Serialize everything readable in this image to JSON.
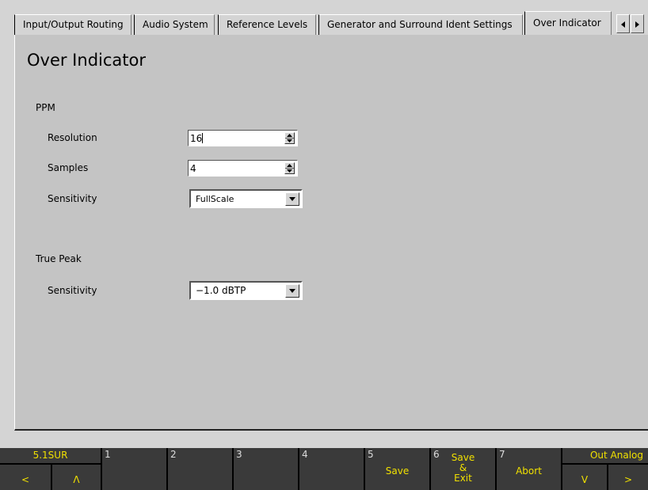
{
  "tabs": [
    {
      "label": "Input/Output Routing",
      "active": false
    },
    {
      "label": "Audio System",
      "active": false
    },
    {
      "label": "Reference Levels",
      "active": false
    },
    {
      "label": "Generator and Surround Ident Settings",
      "active": false
    },
    {
      "label": "Over Indicator",
      "active": true
    }
  ],
  "page": {
    "title": "Over Indicator",
    "ppm": {
      "section_label": "PPM",
      "resolution": {
        "label": "Resolution",
        "value": "16"
      },
      "samples": {
        "label": "Samples",
        "value": "4"
      },
      "sensitivity": {
        "label": "Sensitivity",
        "value": "FullScale"
      }
    },
    "true_peak": {
      "section_label": "True Peak",
      "sensitivity": {
        "label": "Sensitivity",
        "value": "−1.0 dBTP"
      }
    }
  },
  "softkeys": {
    "left_top": "5.1SUR",
    "left_prev": "<",
    "left_up": "Λ",
    "k1": {
      "num": "1",
      "label": ""
    },
    "k2": {
      "num": "2",
      "label": ""
    },
    "k3": {
      "num": "3",
      "label": ""
    },
    "k4": {
      "num": "4",
      "label": ""
    },
    "k5": {
      "num": "5",
      "label": "Save"
    },
    "k6": {
      "num": "6",
      "label": "Save\n&\nExit"
    },
    "k7": {
      "num": "7",
      "label": "Abort"
    },
    "right_top": "Out Analog",
    "right_down": "V",
    "right_next": ">"
  },
  "colors": {
    "softkey_text": "#f0e000",
    "softkey_bg": "#3a3a3a",
    "panel_bg": "#c4c4c4"
  }
}
